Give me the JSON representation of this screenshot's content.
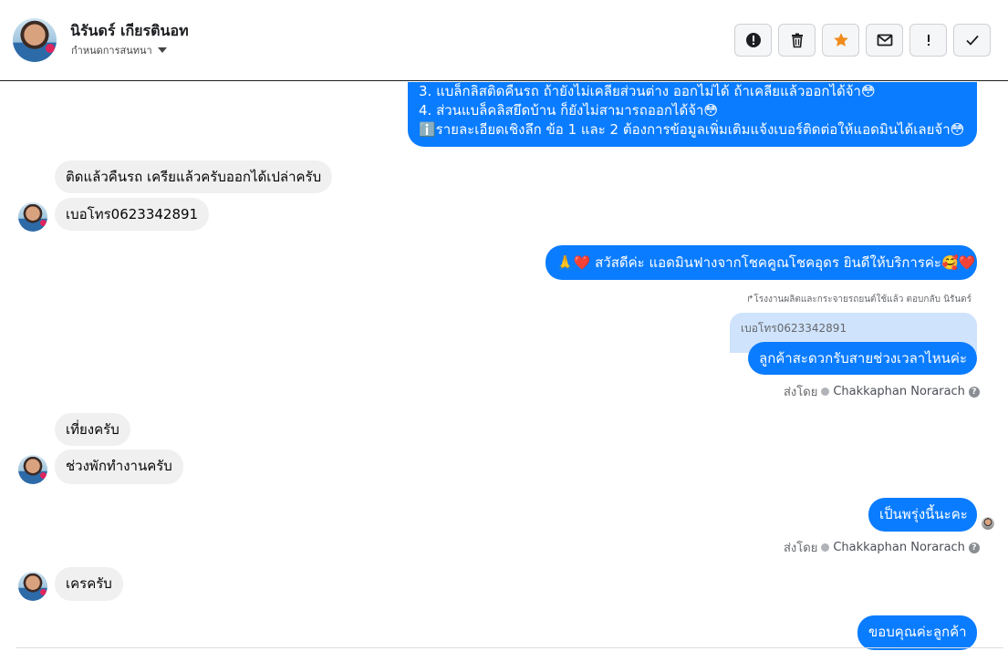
{
  "header": {
    "contact_name": "นิรันดร์ เกียรตินอท",
    "assign_label": "กำหนดการสนทนา"
  },
  "actions": [
    {
      "icon": "alert-icon",
      "label": "Mark as spam"
    },
    {
      "icon": "trash-icon",
      "label": "Delete"
    },
    {
      "icon": "star-icon",
      "label": "Star",
      "color": "#f28b1e"
    },
    {
      "icon": "envelope-icon",
      "label": "Mark unread"
    },
    {
      "icon": "exclamation-icon",
      "label": "Important"
    },
    {
      "icon": "check-icon",
      "label": "Done"
    }
  ],
  "messages": {
    "top_out": {
      "line1": "3. แบล็กลิสติดคืนรถ ถ้ายังไม่เคลียส่วนต่าง ออกไม่ได้ ถ้าเคลียแล้วออกได้จ้า😳",
      "line2": "4. ส่วนแบล็คลิสยึดบ้าน ก็ยังไม่สามารถออกได้จ้า😳",
      "line3": "ℹ️รายละเอียดเชิงลึก ข้อ 1 และ 2 ต้องการข้อมูลเพิ่มเติมแจ้งเบอร์ติดต่อให้แอดมินได้เลยจ้า😳"
    },
    "in1": "ติดแล้วคืนรถ เครียแล้วครับออกได้เปล่าครับ",
    "in2": "เบอโทร0623342891",
    "out_greet": "🙏❤️ สวัสดีค่ะ แอดมินฟางจากโชคคูณโชคอุดร ยินดีให้บริการค่ะ🥰❤️",
    "reply_note": "โรงงานผลิตและกระจายรถยนต์ใช้แล้ว ตอบกลับ นิรันดร์",
    "reply_quote": "เบอโทร0623342891",
    "out_ask": "ลูกค้าสะดวกรับสายช่วงเวลาไหนค่ะ",
    "sent_by_1": "ส่งโดย",
    "agent_1": "Chakkaphan Norarach",
    "in3": "เที่ยงครับ",
    "in4": "ช่วงพักทำงานครับ",
    "out_tomorrow": "เป็นพรุ่งนี้นะคะ",
    "sent_by_2": "ส่งโดย",
    "agent_2": "Chakkaphan Norarach",
    "in5": "เครครับ",
    "out_thanks": "ขอบคุณค่ะลูกค้า"
  }
}
